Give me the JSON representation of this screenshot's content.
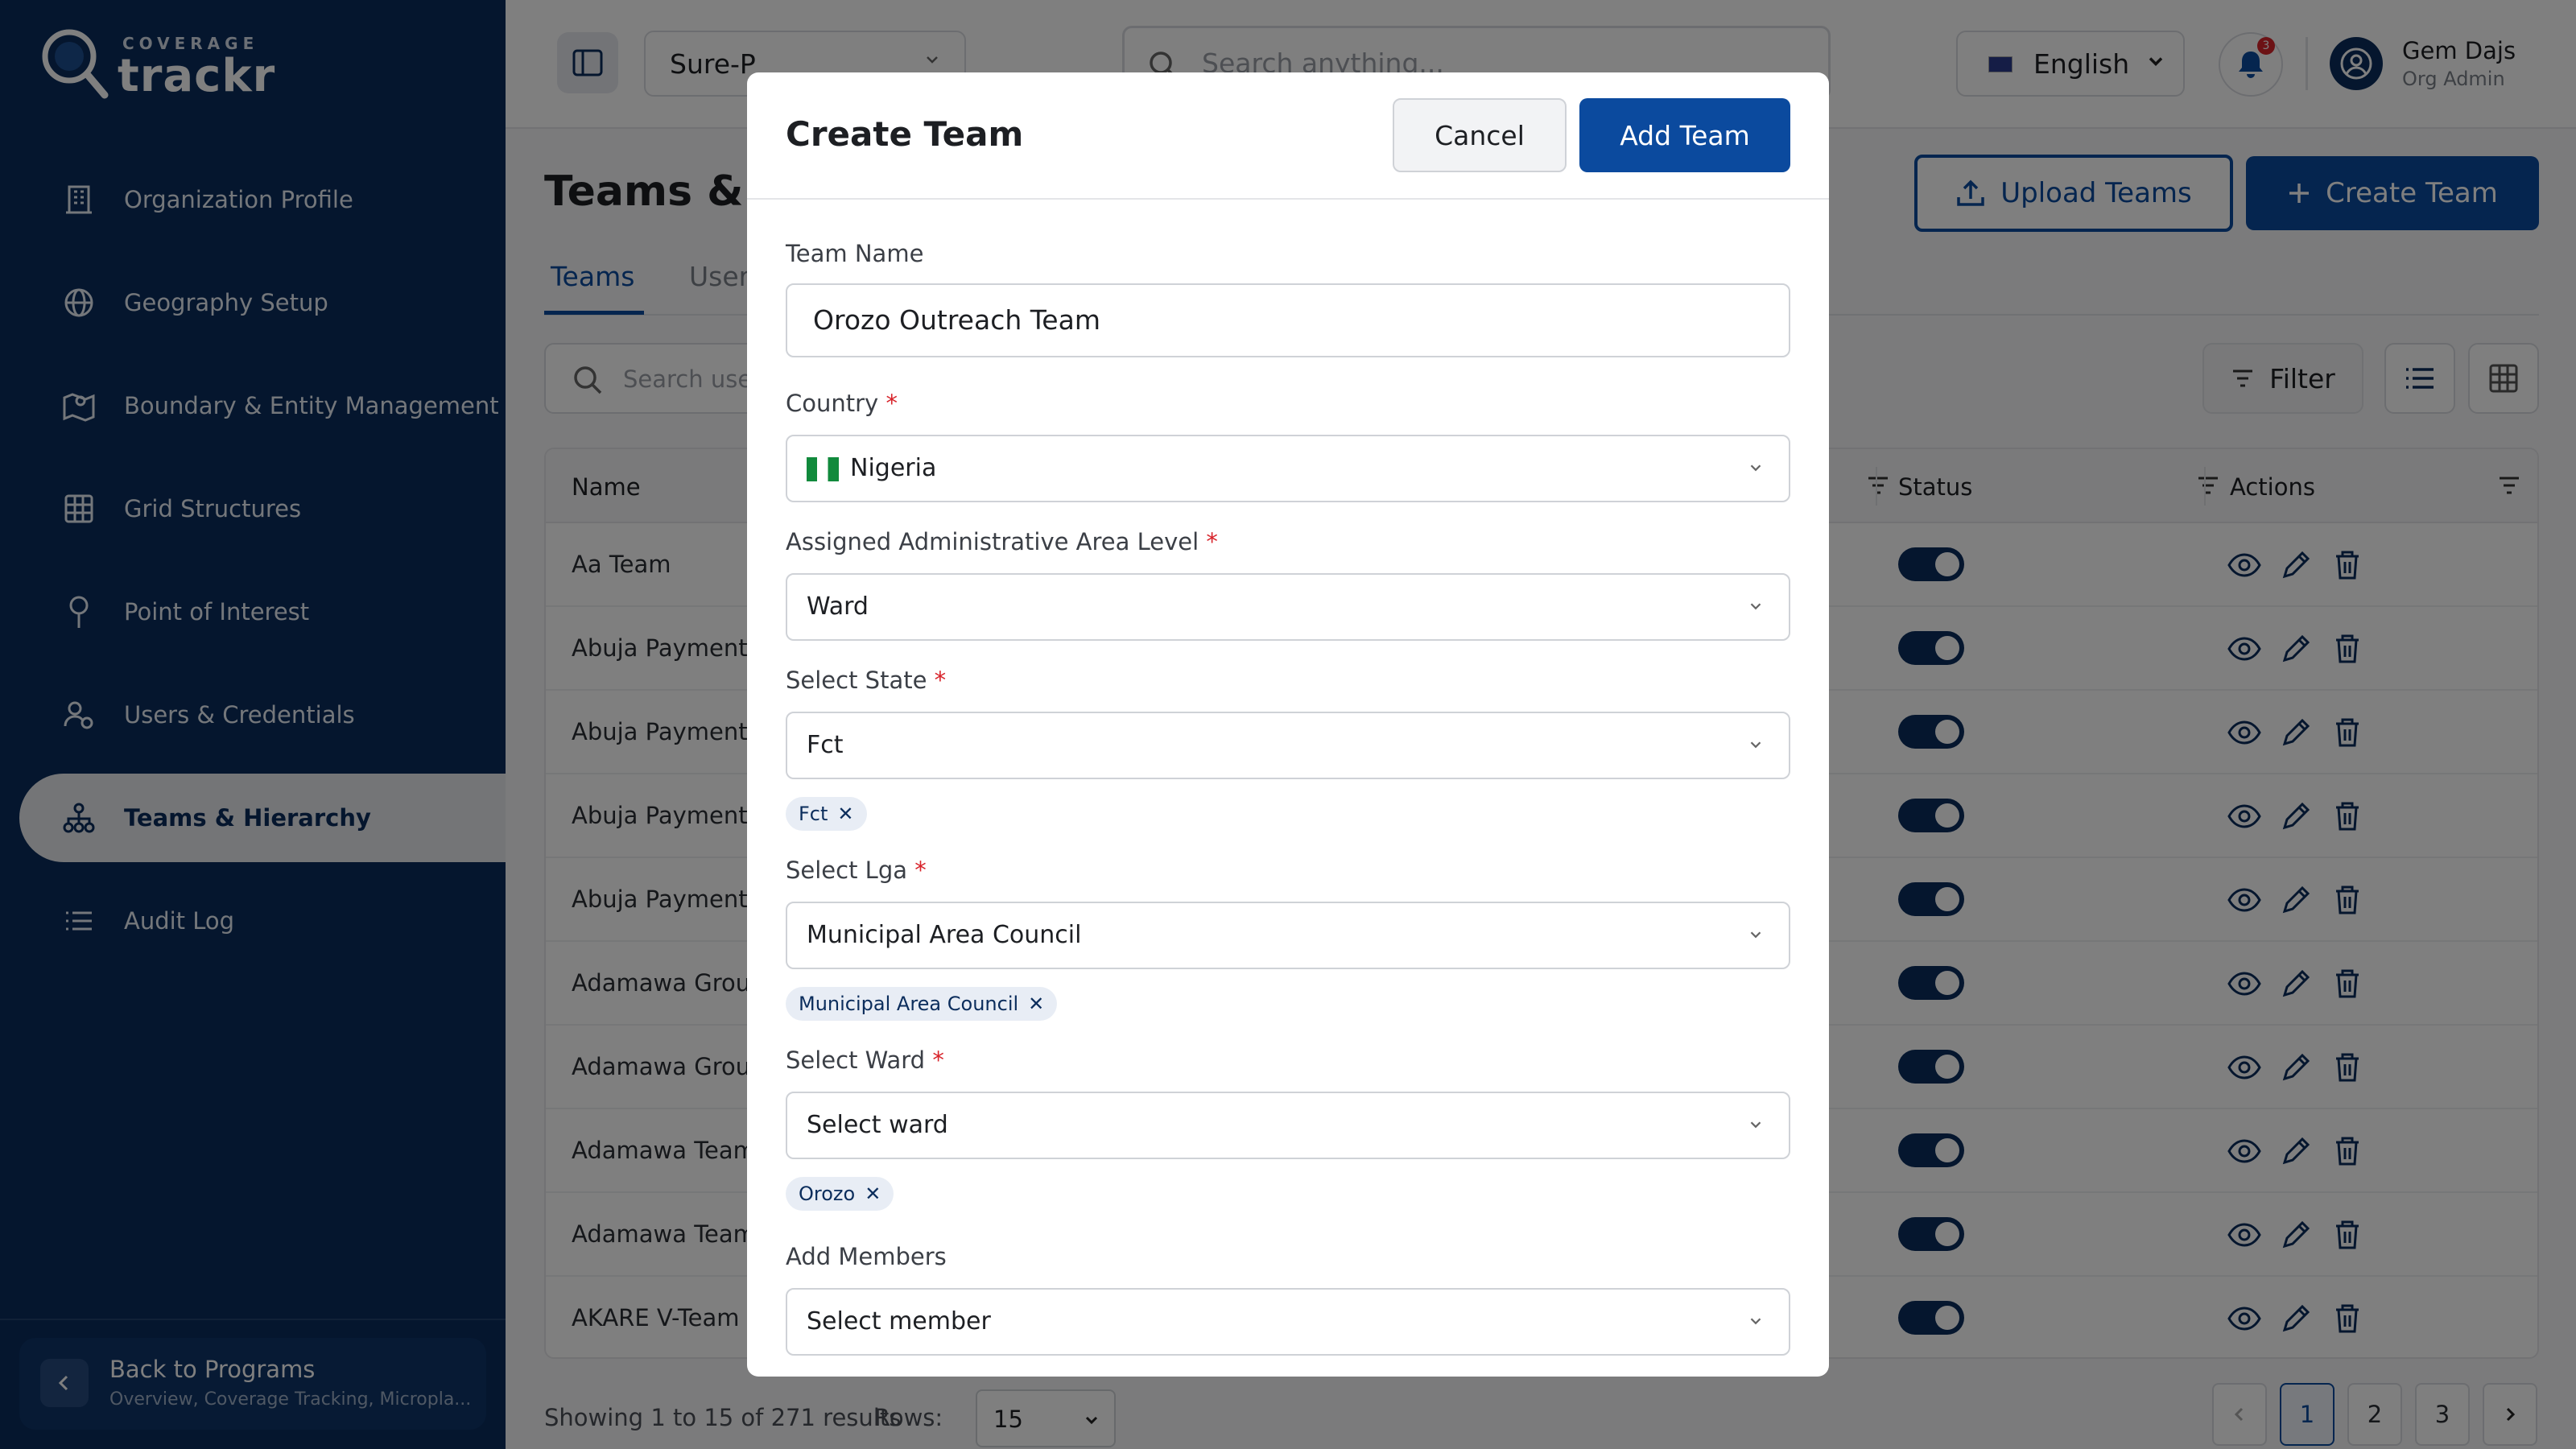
{
  "brand": {
    "small": "COVERAGE",
    "big": "trackr"
  },
  "sidebar": {
    "items": [
      {
        "label": "Organization Profile",
        "icon": "building-icon"
      },
      {
        "label": "Geography Setup",
        "icon": "globe-icon"
      },
      {
        "label": "Boundary & Entity Management",
        "icon": "map-pin-icon"
      },
      {
        "label": "Grid Structures",
        "icon": "grid-icon"
      },
      {
        "label": "Point of Interest",
        "icon": "pin-icon"
      },
      {
        "label": "Users & Credentials",
        "icon": "users-icon"
      },
      {
        "label": "Teams & Hierarchy",
        "icon": "hierarchy-icon"
      },
      {
        "label": "Audit Log",
        "icon": "list-icon"
      }
    ],
    "active_index": 6,
    "back": {
      "title": "Back to Programs",
      "subtitle": "Overview, Coverage Tracking, Micropla..."
    }
  },
  "topbar": {
    "program": "Sure-P",
    "search_placeholder": "Search anything...",
    "language": "English",
    "notifications": "3",
    "user": {
      "name": "Gem Dajs",
      "role": "Org Admin"
    }
  },
  "page": {
    "title": "Teams & Hierarchy",
    "upload_label": "Upload Teams",
    "create_label": "Create Team",
    "tabs": [
      "Teams",
      "Users"
    ],
    "search_placeholder": "Search users",
    "filter_label": "Filter"
  },
  "table": {
    "columns": [
      "Name",
      "Status",
      "Actions"
    ],
    "rows": [
      {
        "name": "Aa Team"
      },
      {
        "name": "Abuja Payment"
      },
      {
        "name": "Abuja Payment"
      },
      {
        "name": "Abuja Payment"
      },
      {
        "name": "Abuja Payment"
      },
      {
        "name": "Adamawa Group"
      },
      {
        "name": "Adamawa Group"
      },
      {
        "name": "Adamawa Team"
      },
      {
        "name": "Adamawa Team"
      },
      {
        "name": "AKARE V-Team"
      }
    ]
  },
  "pagination": {
    "showing": "Showing 1 to 15 of 271 results",
    "rows_label": "Rows:",
    "rows_value": "15",
    "pages": [
      "1",
      "2",
      "3"
    ]
  },
  "modal": {
    "title": "Create Team",
    "cancel_label": "Cancel",
    "add_label": "Add Team",
    "team_name": {
      "label": "Team Name",
      "value": "Orozo Outreach Team"
    },
    "country": {
      "label": "Country",
      "value": "Nigeria"
    },
    "admin_level": {
      "label": "Assigned Administrative Area Level",
      "value": "Ward"
    },
    "state": {
      "label": "Select State",
      "value": "Fct",
      "chip": "Fct"
    },
    "lga": {
      "label": "Select Lga",
      "value": "Municipal Area Council",
      "chip": "Municipal Area Council"
    },
    "ward": {
      "label": "Select Ward",
      "placeholder": "Select ward",
      "chip": "Orozo"
    },
    "members": {
      "label": "Add Members",
      "placeholder": "Select member"
    }
  },
  "colors": {
    "primary": "#0b4a9e",
    "sidebar": "#0b2d5c",
    "required": "#d8242b"
  }
}
